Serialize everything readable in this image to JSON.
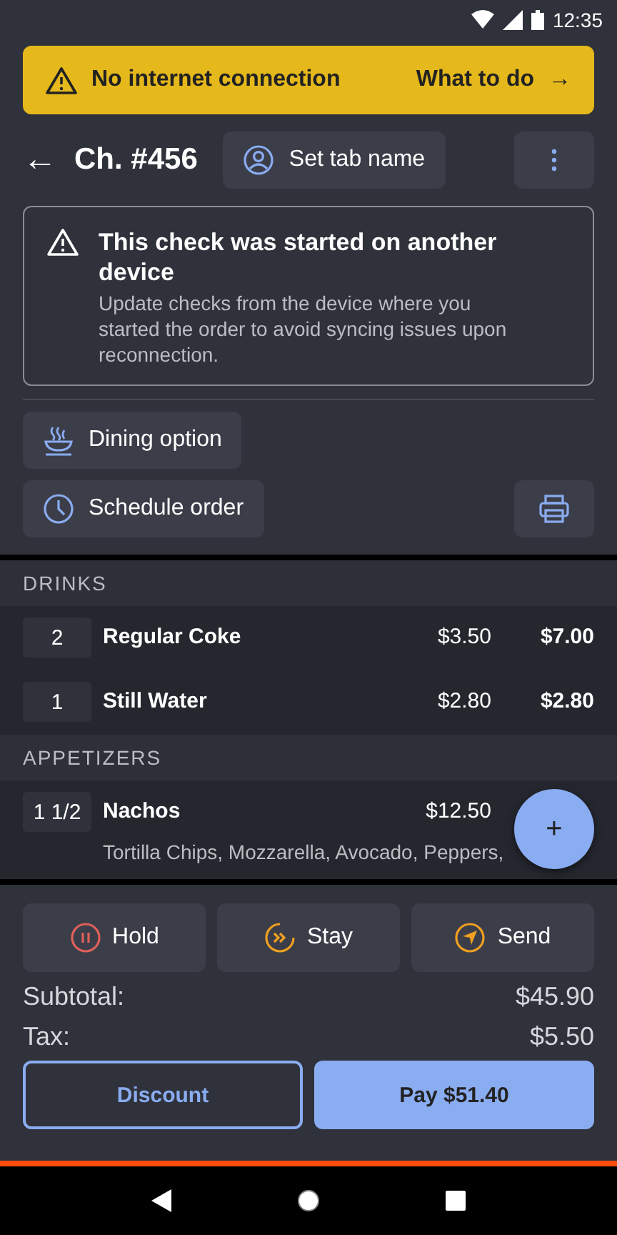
{
  "status_bar": {
    "time": "12:35"
  },
  "alert_banner": {
    "message": "No internet connection",
    "action": "What to do",
    "arrow": "→"
  },
  "header": {
    "back": "←",
    "title": "Ch. #456",
    "tab_name_button": "Set tab name"
  },
  "notice": {
    "title": "This check was started on another device",
    "body": "Update checks from the device where you started the order to avoid syncing issues upon reconnection."
  },
  "options": [
    {
      "kind": "dining",
      "label": "Dining option"
    },
    {
      "kind": "schedule",
      "label": "Schedule order"
    }
  ],
  "sections": [
    {
      "title": "DRINKS",
      "items": [
        {
          "qty": "2",
          "name": "Regular Coke",
          "price": "$3.50",
          "total": "$7.00"
        },
        {
          "qty": "1",
          "name": "Still Water",
          "price": "$2.80",
          "total": "$2.80"
        }
      ]
    },
    {
      "title": "APPETIZERS",
      "items": [
        {
          "qty": "1 1/2",
          "name": "Nachos",
          "price": "$12.50",
          "modifiers": "Tortilla Chips, Mozzarella, Avocado, Peppers,"
        }
      ]
    }
  ],
  "fab": "+",
  "actions": [
    {
      "kind": "hold",
      "label": "Hold"
    },
    {
      "kind": "stay",
      "label": "Stay"
    },
    {
      "kind": "send",
      "label": "Send"
    }
  ],
  "totals": [
    {
      "label": "Subtotal:",
      "value": "$45.90"
    },
    {
      "label": "Tax:",
      "value": "$5.50"
    }
  ],
  "discount_button": "Discount",
  "pay_button": "Pay $51.40"
}
